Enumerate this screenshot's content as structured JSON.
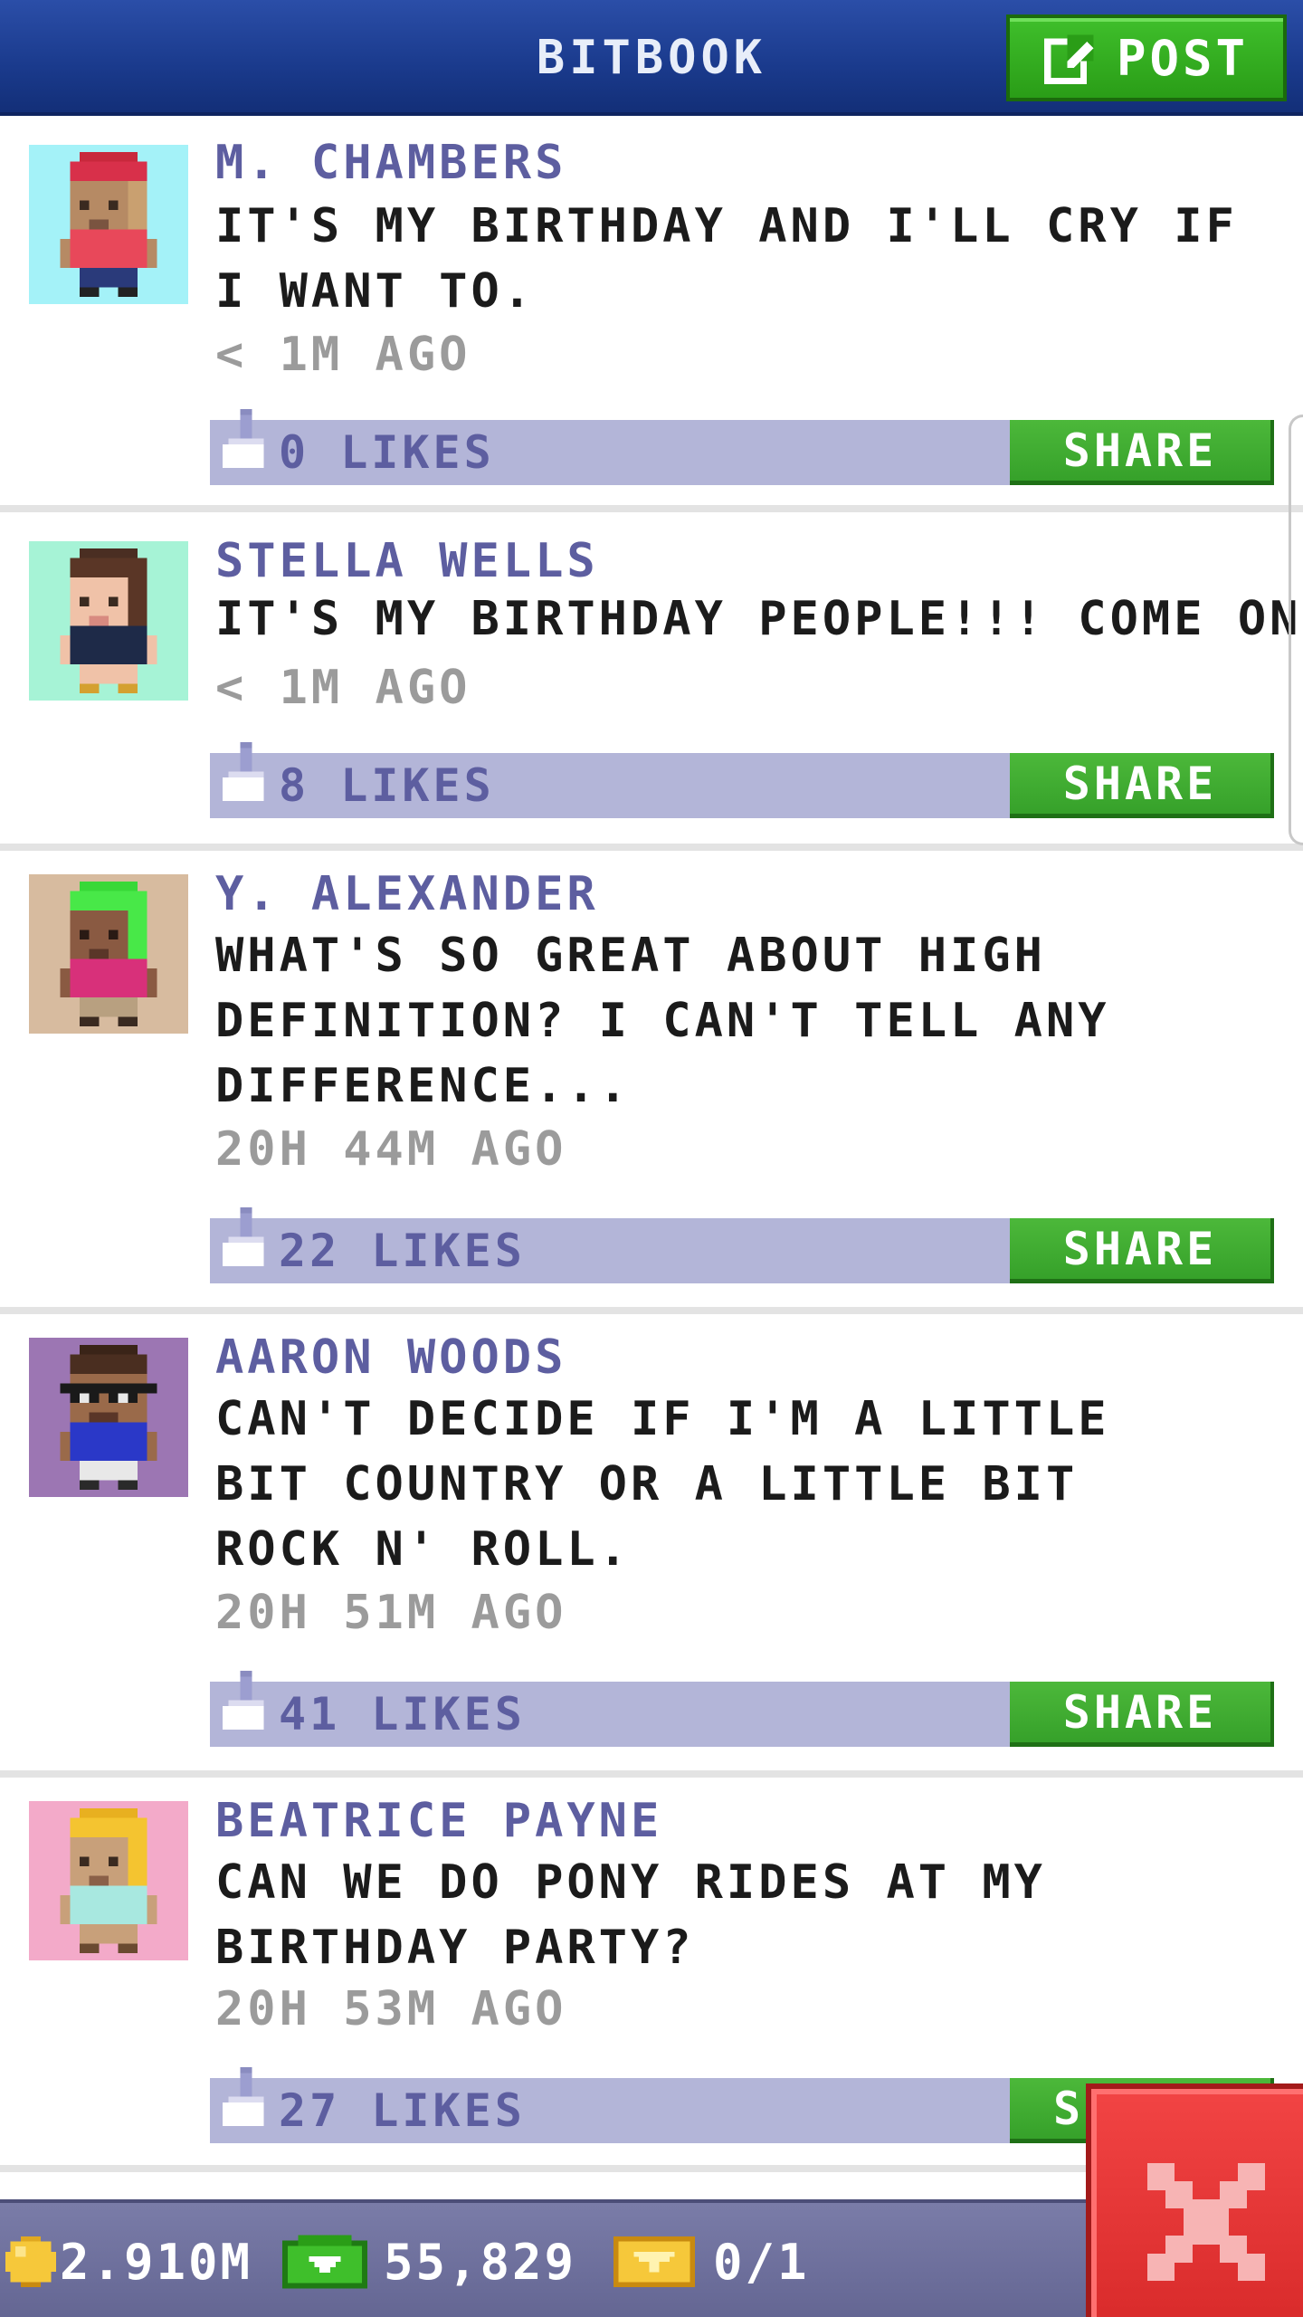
{
  "header": {
    "title": "BITBOOK",
    "post_label": "POST"
  },
  "posts": [
    {
      "author": "M. CHAMBERS",
      "message": "IT'S MY BIRTHDAY AND I'LL CRY IF I WANT TO.",
      "time": "< 1M AGO",
      "likes": "0 LIKES",
      "share_label": "SHARE",
      "avatar_bg": "#a4f2f8",
      "avatar_icon": "avatar-red-hat-icon"
    },
    {
      "author": "STELLA WELLS",
      "message": "IT'S MY BIRTHDAY PEOPLE!!! COME ON!",
      "time": "< 1M AGO",
      "likes": "8 LIKES",
      "share_label": "SHARE",
      "avatar_bg": "#a6f3d6",
      "avatar_icon": "avatar-brown-hair-icon"
    },
    {
      "author": "Y. ALEXANDER",
      "message": "WHAT'S SO GREAT ABOUT HIGH DEFINITION? I CAN'T TELL ANY DIFFERENCE...",
      "time": "20H 44M AGO",
      "likes": "22 LIKES",
      "share_label": "SHARE",
      "avatar_bg": "#d7bb9f",
      "avatar_icon": "avatar-green-hair-icon"
    },
    {
      "author": "AARON WOODS",
      "message": "CAN'T DECIDE IF I'M A LITTLE BIT COUNTRY OR A LITTLE BIT ROCK N' ROLL.",
      "time": "20H 51M AGO",
      "likes": "41 LIKES",
      "share_label": "SHARE",
      "avatar_bg": "#9c76b3",
      "avatar_icon": "avatar-glasses-icon"
    },
    {
      "author": "BEATRICE PAYNE",
      "message": "CAN WE DO PONY RIDES AT MY BIRTHDAY PARTY?",
      "time": "20H 53M AGO",
      "likes": "27 LIKES",
      "share_label": "SH",
      "avatar_bg": "#f3aac9",
      "avatar_icon": "avatar-blonde-hair-icon"
    }
  ],
  "status": {
    "coins": "2.910M",
    "bux": "55,829",
    "tickets": "0/1"
  },
  "colors": {
    "header_blue": "#1a3a8c",
    "accent_green": "#3fbf2b",
    "likes_bar": "#b3b5d8",
    "name_purple": "#5d5ea0",
    "close_red": "#e03333"
  }
}
